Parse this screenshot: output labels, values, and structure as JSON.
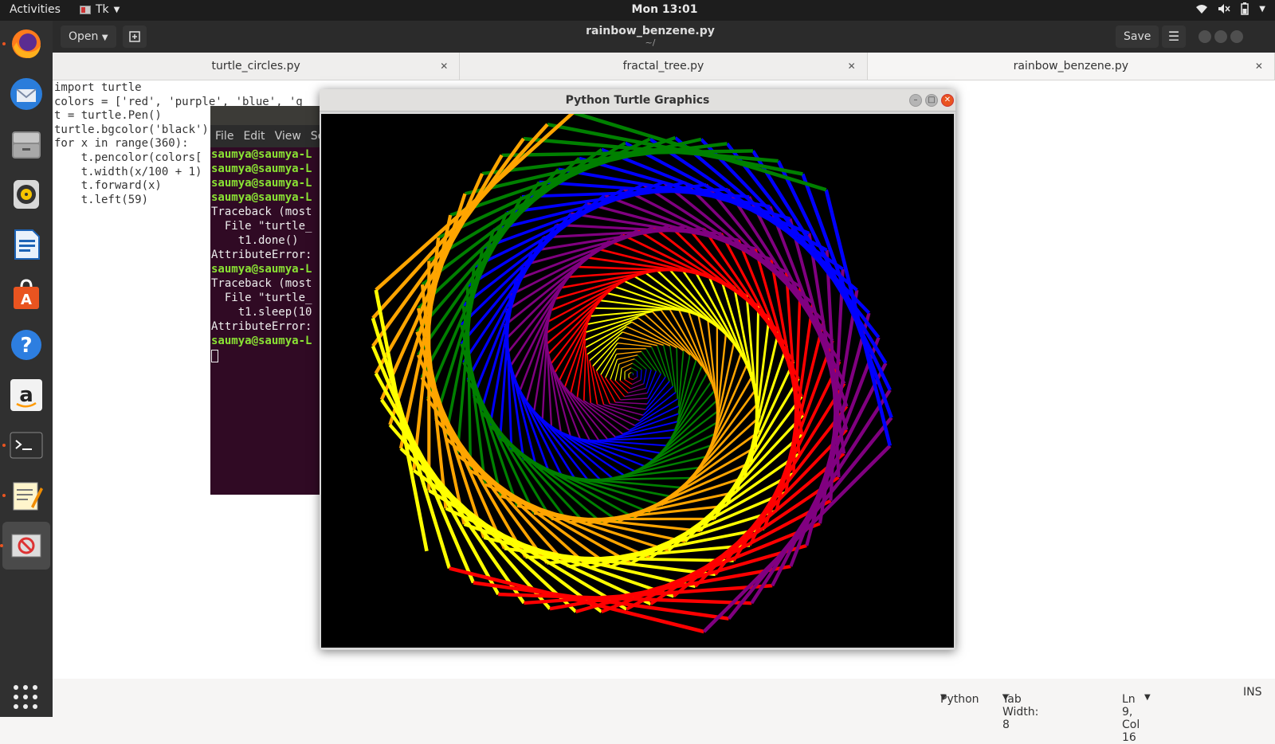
{
  "topbar": {
    "activities": "Activities",
    "app_name": "Tk",
    "clock": "Mon 13:01"
  },
  "dock": {
    "items": [
      {
        "name": "firefox-icon",
        "running": true
      },
      {
        "name": "thunderbird-icon",
        "running": false
      },
      {
        "name": "files-icon",
        "running": false
      },
      {
        "name": "rhythmbox-icon",
        "running": false
      },
      {
        "name": "libreoffice-writer-icon",
        "running": false
      },
      {
        "name": "software-center-icon",
        "running": false
      },
      {
        "name": "help-icon",
        "running": false
      },
      {
        "name": "amazon-icon",
        "running": false
      },
      {
        "name": "terminal-icon",
        "running": true
      },
      {
        "name": "text-editor-icon",
        "running": true
      },
      {
        "name": "tk-app-icon",
        "running": true
      }
    ]
  },
  "header": {
    "open_label": "Open",
    "title": "rainbow_benzene.py",
    "subtitle": "~/",
    "save_label": "Save"
  },
  "tabs": [
    {
      "label": "turtle_circles.py"
    },
    {
      "label": "fractal_tree.py"
    },
    {
      "label": "rainbow_benzene.py"
    }
  ],
  "editor": {
    "code_lines": [
      "import turtle",
      "colors = ['red', 'purple', 'blue', 'g",
      "t = turtle.Pen()",
      "turtle.bgcolor('black')",
      "for x in range(360):",
      "    t.pencolor(colors[",
      "    t.width(x/100 + 1)",
      "    t.forward(x)",
      "    t.left(59)"
    ]
  },
  "terminal": {
    "menu": [
      "File",
      "Edit",
      "View",
      "Se"
    ],
    "lines": [
      {
        "text": "saumya@saumya-L",
        "prompt": true
      },
      {
        "text": "saumya@saumya-L",
        "prompt": true
      },
      {
        "text": "saumya@saumya-L",
        "prompt": true
      },
      {
        "text": "saumya@saumya-L",
        "prompt": true
      },
      {
        "text": "Traceback (most",
        "prompt": false
      },
      {
        "text": "  File \"turtle_",
        "prompt": false
      },
      {
        "text": "    t1.done()",
        "prompt": false
      },
      {
        "text": "AttributeError:",
        "prompt": false
      },
      {
        "text": "saumya@saumya-L",
        "prompt": true
      },
      {
        "text": "Traceback (most",
        "prompt": false
      },
      {
        "text": "  File \"turtle_",
        "prompt": false
      },
      {
        "text": "    t1.sleep(10",
        "prompt": false
      },
      {
        "text": "AttributeError:",
        "prompt": false
      },
      {
        "text": "saumya@saumya-L",
        "prompt": true
      }
    ]
  },
  "turtle_window": {
    "title": "Python Turtle Graphics",
    "background": "#000000",
    "drawing": {
      "colors": [
        "red",
        "purple",
        "blue",
        "green",
        "orange",
        "yellow"
      ],
      "steps": 360,
      "turn_degrees": 59
    }
  },
  "statusbar": {
    "language": "Python",
    "tab_width": "Tab Width: 8",
    "position": "Ln 9, Col 16",
    "mode": "INS"
  }
}
